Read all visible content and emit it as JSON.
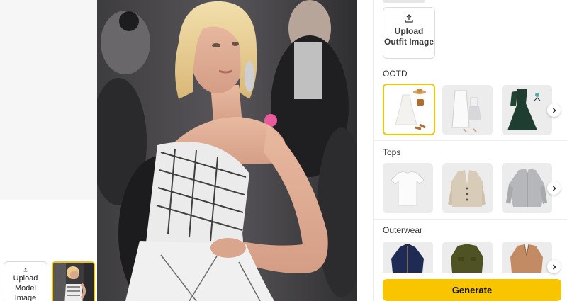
{
  "left_pane": {
    "upload_model_label": "Upload Model Image",
    "upload_icon": "upload-icon"
  },
  "main": {
    "photo_description_icon": "model-photo"
  },
  "panel": {
    "upload_outfit_label": "Upload Outfit Image",
    "sections": [
      {
        "title": "OOTD",
        "items": [
          "white-dress-outfit",
          "white-coat-outfit",
          "green-gown-outfit"
        ]
      },
      {
        "title": "Tops",
        "items": [
          "white-tshirt",
          "beige-cardigan",
          "grey-shirt"
        ]
      },
      {
        "title": "Outerwear",
        "items": [
          "navy-jacket",
          "olive-jacket",
          "camel-blazer"
        ]
      }
    ],
    "generate_label": "Generate"
  },
  "colors": {
    "accent": "#f9c500",
    "panel_bg": "#ffffff",
    "left_bg": "#f6f6f7"
  }
}
